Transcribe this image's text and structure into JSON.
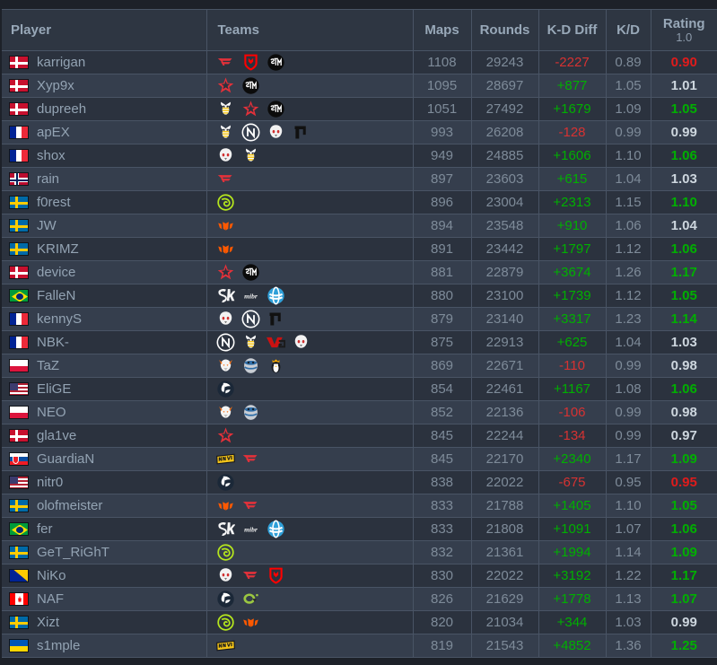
{
  "columns": {
    "player": "Player",
    "teams": "Teams",
    "maps": "Maps",
    "rounds": "Rounds",
    "kd_diff": "K-D Diff",
    "kd": "K/D",
    "rating": "Rating",
    "rating_sub": "1.0"
  },
  "colors": {
    "positive": "#00b000",
    "negative": "#d63232",
    "rating_good": "#00b000",
    "rating_mid": "#cdd6de",
    "rating_bad": "#e01b1b",
    "row_odd": "#2b323e",
    "row_even": "#353e4d",
    "header_bg": "#2e3642",
    "grid": "#495465",
    "text_muted": "#7e8b99",
    "text_player": "#93a3b3"
  },
  "rows": [
    {
      "player": "karrigan",
      "flag": "dk",
      "teams": [
        "faze",
        "mouz",
        "tsm"
      ],
      "maps": "1108",
      "rounds": "29243",
      "kd_diff": "-2227",
      "kd": "0.89",
      "rating": "0.90",
      "kdd_sign": "neg",
      "rating_class": "bad"
    },
    {
      "player": "Xyp9x",
      "flag": "dk",
      "teams": [
        "astralis",
        "tsm"
      ],
      "maps": "1095",
      "rounds": "28697",
      "kd_diff": "+877",
      "kd": "1.05",
      "rating": "1.01",
      "kdd_sign": "pos",
      "rating_class": "mid"
    },
    {
      "player": "dupreeh",
      "flag": "dk",
      "teams": [
        "vitality",
        "astralis",
        "tsm"
      ],
      "maps": "1051",
      "rounds": "27492",
      "kd_diff": "+1679",
      "kd": "1.09",
      "rating": "1.05",
      "kdd_sign": "pos",
      "rating_class": "good"
    },
    {
      "player": "apEX",
      "flag": "fr",
      "teams": [
        "vitality",
        "envy",
        "g2",
        "titan"
      ],
      "maps": "993",
      "rounds": "26208",
      "kd_diff": "-128",
      "kd": "0.99",
      "rating": "0.99",
      "kdd_sign": "neg",
      "rating_class": "mid"
    },
    {
      "player": "shox",
      "flag": "fr",
      "teams": [
        "g2",
        "vitality"
      ],
      "maps": "949",
      "rounds": "24885",
      "kd_diff": "+1606",
      "kd": "1.10",
      "rating": "1.06",
      "kdd_sign": "pos",
      "rating_class": "good"
    },
    {
      "player": "rain",
      "flag": "no",
      "teams": [
        "faze"
      ],
      "maps": "897",
      "rounds": "23603",
      "kd_diff": "+615",
      "kd": "1.04",
      "rating": "1.03",
      "kdd_sign": "pos",
      "rating_class": "mid"
    },
    {
      "player": "f0rest",
      "flag": "se",
      "teams": [
        "nip"
      ],
      "maps": "896",
      "rounds": "23004",
      "kd_diff": "+2313",
      "kd": "1.15",
      "rating": "1.10",
      "kdd_sign": "pos",
      "rating_class": "good"
    },
    {
      "player": "JW",
      "flag": "se",
      "teams": [
        "fnatic"
      ],
      "maps": "894",
      "rounds": "23548",
      "kd_diff": "+910",
      "kd": "1.06",
      "rating": "1.04",
      "kdd_sign": "pos",
      "rating_class": "mid"
    },
    {
      "player": "KRIMZ",
      "flag": "se",
      "teams": [
        "fnatic"
      ],
      "maps": "891",
      "rounds": "23442",
      "kd_diff": "+1797",
      "kd": "1.12",
      "rating": "1.06",
      "kdd_sign": "pos",
      "rating_class": "good"
    },
    {
      "player": "device",
      "flag": "dk",
      "teams": [
        "astralis",
        "tsm"
      ],
      "maps": "881",
      "rounds": "22879",
      "kd_diff": "+3674",
      "kd": "1.26",
      "rating": "1.17",
      "kdd_sign": "pos",
      "rating_class": "good"
    },
    {
      "player": "FalleN",
      "flag": "br",
      "teams": [
        "sk",
        "mibr",
        "luminosity"
      ],
      "maps": "880",
      "rounds": "23100",
      "kd_diff": "+1739",
      "kd": "1.12",
      "rating": "1.05",
      "kdd_sign": "pos",
      "rating_class": "good"
    },
    {
      "player": "kennyS",
      "flag": "fr",
      "teams": [
        "g2",
        "envy",
        "titan"
      ],
      "maps": "879",
      "rounds": "23140",
      "kd_diff": "+3317",
      "kd": "1.23",
      "rating": "1.14",
      "kdd_sign": "pos",
      "rating_class": "good"
    },
    {
      "player": "NBK-",
      "flag": "fr",
      "teams": [
        "envy",
        "vitality",
        "vg",
        "g2"
      ],
      "maps": "875",
      "rounds": "22913",
      "kd_diff": "+625",
      "kd": "1.04",
      "rating": "1.03",
      "kdd_sign": "pos",
      "rating_class": "mid"
    },
    {
      "player": "TaZ",
      "flag": "pl",
      "teams": [
        "virtus",
        "hellraisers",
        "kinguin"
      ],
      "maps": "869",
      "rounds": "22671",
      "kd_diff": "-110",
      "kd": "0.99",
      "rating": "0.98",
      "kdd_sign": "neg",
      "rating_class": "mid"
    },
    {
      "player": "EliGE",
      "flag": "us",
      "teams": [
        "liquid"
      ],
      "maps": "854",
      "rounds": "22461",
      "kd_diff": "+1167",
      "kd": "1.08",
      "rating": "1.06",
      "kdd_sign": "pos",
      "rating_class": "good"
    },
    {
      "player": "NEO",
      "flag": "pl",
      "teams": [
        "virtus",
        "hellraisers"
      ],
      "maps": "852",
      "rounds": "22136",
      "kd_diff": "-106",
      "kd": "0.99",
      "rating": "0.98",
      "kdd_sign": "neg",
      "rating_class": "mid"
    },
    {
      "player": "gla1ve",
      "flag": "dk",
      "teams": [
        "astralis"
      ],
      "maps": "845",
      "rounds": "22244",
      "kd_diff": "-134",
      "kd": "0.99",
      "rating": "0.97",
      "kdd_sign": "neg",
      "rating_class": "mid"
    },
    {
      "player": "GuardiaN",
      "flag": "sk",
      "teams": [
        "navi",
        "faze"
      ],
      "maps": "845",
      "rounds": "22170",
      "kd_diff": "+2340",
      "kd": "1.17",
      "rating": "1.09",
      "kdd_sign": "pos",
      "rating_class": "good"
    },
    {
      "player": "nitr0",
      "flag": "us",
      "teams": [
        "liquid"
      ],
      "maps": "838",
      "rounds": "22022",
      "kd_diff": "-675",
      "kd": "0.95",
      "rating": "0.95",
      "kdd_sign": "neg",
      "rating_class": "bad"
    },
    {
      "player": "olofmeister",
      "flag": "se",
      "teams": [
        "fnatic",
        "faze"
      ],
      "maps": "833",
      "rounds": "21788",
      "kd_diff": "+1405",
      "kd": "1.10",
      "rating": "1.05",
      "kdd_sign": "pos",
      "rating_class": "good"
    },
    {
      "player": "fer",
      "flag": "br",
      "teams": [
        "sk",
        "mibr",
        "luminosity"
      ],
      "maps": "833",
      "rounds": "21808",
      "kd_diff": "+1091",
      "kd": "1.07",
      "rating": "1.06",
      "kdd_sign": "pos",
      "rating_class": "good"
    },
    {
      "player": "GeT_RiGhT",
      "flag": "se",
      "teams": [
        "nip"
      ],
      "maps": "832",
      "rounds": "21361",
      "kd_diff": "+1994",
      "kd": "1.14",
      "rating": "1.09",
      "kdd_sign": "pos",
      "rating_class": "good"
    },
    {
      "player": "NiKo",
      "flag": "ba",
      "teams": [
        "g2",
        "faze",
        "mouz"
      ],
      "maps": "830",
      "rounds": "22022",
      "kd_diff": "+3192",
      "kd": "1.22",
      "rating": "1.17",
      "kdd_sign": "pos",
      "rating_class": "good"
    },
    {
      "player": "NAF",
      "flag": "ca",
      "teams": [
        "liquid",
        "optic"
      ],
      "maps": "826",
      "rounds": "21629",
      "kd_diff": "+1778",
      "kd": "1.13",
      "rating": "1.07",
      "kdd_sign": "pos",
      "rating_class": "good"
    },
    {
      "player": "Xizt",
      "flag": "se",
      "teams": [
        "nip",
        "fnatic"
      ],
      "maps": "820",
      "rounds": "21034",
      "kd_diff": "+344",
      "kd": "1.03",
      "rating": "0.99",
      "kdd_sign": "pos",
      "rating_class": "mid"
    },
    {
      "player": "s1mple",
      "flag": "ua",
      "teams": [
        "navi"
      ],
      "maps": "819",
      "rounds": "21543",
      "kd_diff": "+4852",
      "kd": "1.36",
      "rating": "1.25",
      "kdd_sign": "pos",
      "rating_class": "good"
    }
  ]
}
